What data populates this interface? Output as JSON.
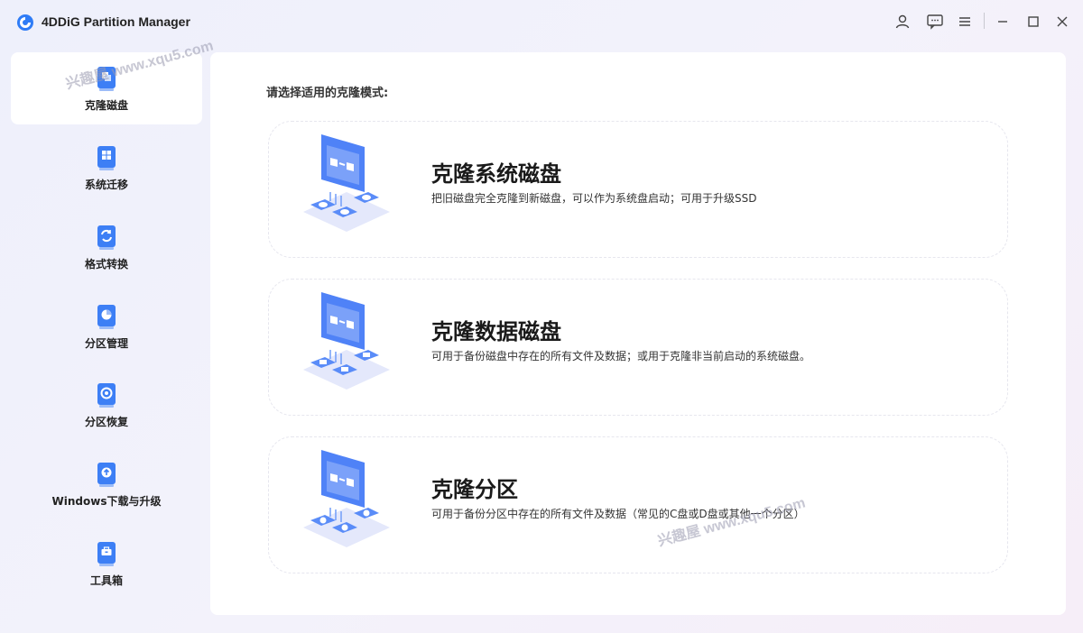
{
  "app": {
    "title": "4DDiG Partition Manager"
  },
  "window_controls": [
    "account-icon",
    "feedback-icon",
    "menu-icon",
    "minimize-icon",
    "maximize-icon",
    "close-icon"
  ],
  "sidebar": {
    "items": [
      {
        "label": "克隆磁盘",
        "icon": "clone-disk-icon",
        "active": true
      },
      {
        "label": "系统迁移",
        "icon": "system-migrate-icon",
        "active": false
      },
      {
        "label": "格式转换",
        "icon": "format-convert-icon",
        "active": false
      },
      {
        "label": "分区管理",
        "icon": "partition-manage-icon",
        "active": false
      },
      {
        "label": "分区恢复",
        "icon": "partition-recover-icon",
        "active": false
      },
      {
        "label": "Windows下载与升级",
        "icon": "windows-download-icon",
        "active": false
      },
      {
        "label": "工具箱",
        "icon": "toolbox-icon",
        "active": false
      }
    ]
  },
  "main": {
    "prompt": "请选择适用的克隆模式:",
    "cards": [
      {
        "title": "克隆系统磁盘",
        "desc": "把旧磁盘完全克隆到新磁盘，可以作为系统盘启动；可用于升级SSD"
      },
      {
        "title": "克隆数据磁盘",
        "desc": "可用于备份磁盘中存在的所有文件及数据；或用于克隆非当前启动的系统磁盘。"
      },
      {
        "title": "克隆分区",
        "desc": "可用于备份分区中存在的所有文件及数据（常见的C盘或D盘或其他一个分区）"
      }
    ]
  },
  "watermarks": [
    "兴趣屋 www.xqu5.com",
    "兴趣屋 www.xqu5.com"
  ],
  "colors": {
    "accent": "#3d7ff5",
    "background": "#f1f1fa",
    "panel": "#ffffff"
  }
}
